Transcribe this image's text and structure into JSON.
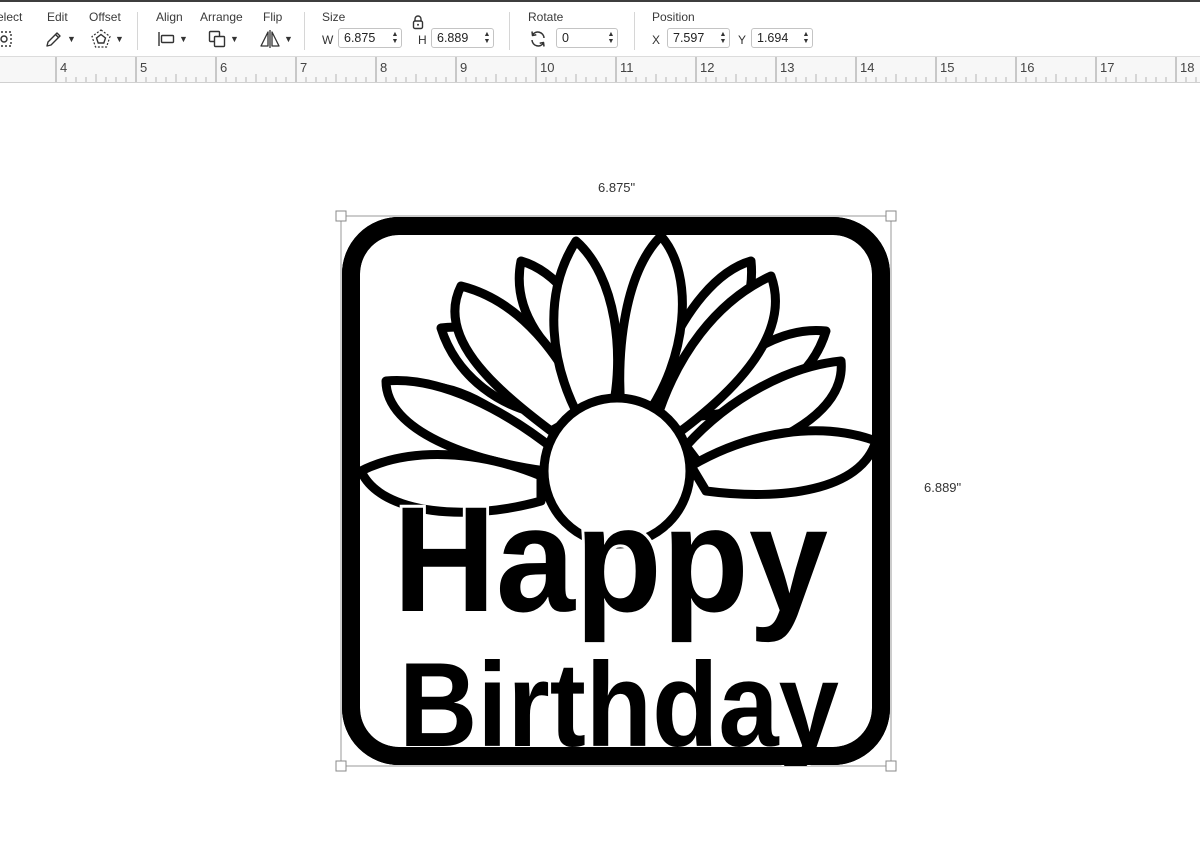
{
  "toolbar": {
    "select_label": "elect",
    "edit_label": "Edit",
    "offset_label": "Offset",
    "align_label": "Align",
    "arrange_label": "Arrange",
    "flip_label": "Flip",
    "size_label": "Size",
    "width_label": "W",
    "width_value": "6.875",
    "height_label": "H",
    "height_value": "6.889",
    "rotate_label": "Rotate",
    "rotate_value": "0",
    "position_label": "Position",
    "x_label": "X",
    "x_value": "7.597",
    "y_label": "Y",
    "y_value": "1.694",
    "icons": {
      "select": "select-icon",
      "edit": "pencil-icon",
      "offset": "offset-icon",
      "align": "align-left-icon",
      "arrange": "arrange-icon",
      "flip": "flip-icon",
      "lock": "lock-icon",
      "rotate": "rotate-icon"
    }
  },
  "ruler": {
    "labels": [
      "4",
      "5",
      "6",
      "7",
      "8",
      "9",
      "10",
      "11",
      "12",
      "13",
      "14",
      "15",
      "16",
      "17",
      "18"
    ]
  },
  "canvas": {
    "width_dimension": "6.875\"",
    "height_dimension": "6.889\"",
    "design_text_line1": "Happy",
    "design_text_line2": "Birthday"
  },
  "colors": {
    "design_stroke": "#000000",
    "selection_box": "#9a9a9a",
    "toolbar_bg": "#ffffff",
    "ruler_bg": "#f7f7f7"
  }
}
